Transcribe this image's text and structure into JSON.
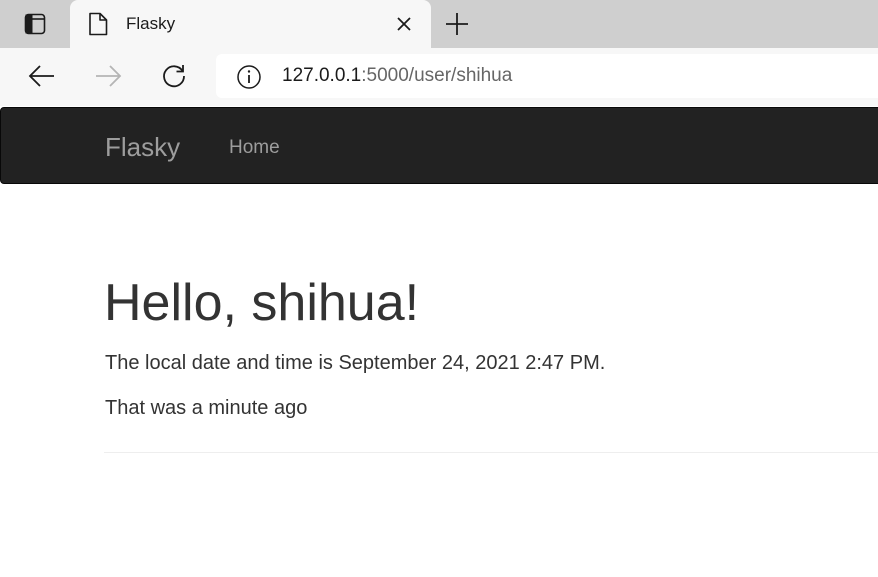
{
  "browser": {
    "tab": {
      "title": "Flasky"
    },
    "address": {
      "host": "127.0.0.1",
      "rest": ":5000/user/shihua"
    },
    "icons": {
      "tab_actions": "tab-actions-icon",
      "page": "page-icon",
      "close": "close-icon",
      "new_tab": "plus-icon",
      "back": "back-arrow-icon",
      "forward": "forward-arrow-icon",
      "refresh": "refresh-icon",
      "site_info": "info-icon"
    }
  },
  "navbar": {
    "brand": "Flasky",
    "links": [
      {
        "label": "Home"
      }
    ]
  },
  "content": {
    "greeting": "Hello, shihua!",
    "datetime": "The local date and time is September 24, 2021 2:47 PM.",
    "ago": "That was a minute ago"
  },
  "colors": {
    "navbar_bg": "#222222",
    "navbar_text": "#9d9d9d",
    "text": "#333333",
    "tabstrip_bg": "#cfcfcf",
    "toolbar_bg": "#f7f7f7"
  }
}
